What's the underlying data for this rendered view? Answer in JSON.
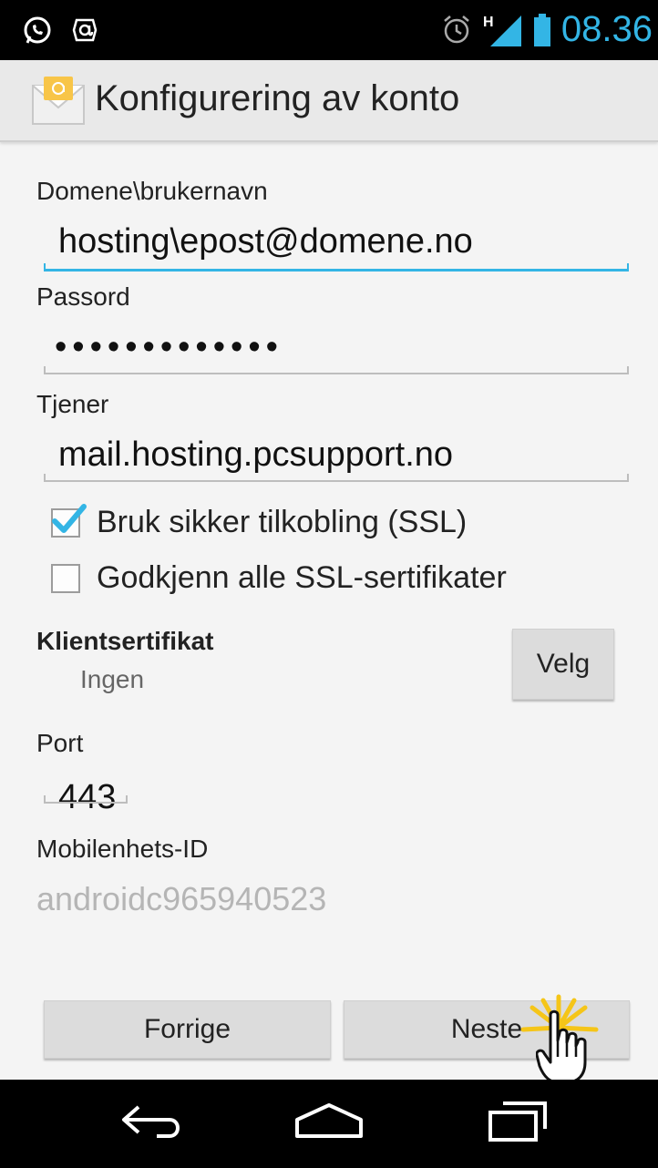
{
  "status_bar": {
    "time": "08.36",
    "network_type": "H",
    "icons": [
      "whatsapp-icon",
      "at-sign-icon",
      "alarm-icon",
      "signal-icon",
      "battery-icon"
    ]
  },
  "action_bar": {
    "title": "Konfigurering av konto",
    "app_icon": "email-envelope-icon"
  },
  "form": {
    "domain_user": {
      "label": "Domene\\brukernavn",
      "value": "hosting\\epost@domene.no"
    },
    "password": {
      "label": "Passord",
      "value": "•••••••••••••"
    },
    "server": {
      "label": "Tjener",
      "value": "mail.hosting.pcsupport.no"
    },
    "use_ssl": {
      "label": "Bruk sikker tilkobling (SSL)",
      "checked": true
    },
    "accept_all_certs": {
      "label": "Godkjenn alle SSL-sertifikater",
      "checked": false
    },
    "client_cert": {
      "label": "Klientsertifikat",
      "value": "Ingen",
      "button": "Velg"
    },
    "port": {
      "label": "Port",
      "value": "443"
    },
    "device_id": {
      "label": "Mobilenhets-ID",
      "value": "androidc965940523"
    }
  },
  "buttons": {
    "previous": "Forrige",
    "next": "Neste"
  },
  "nav_bar": {
    "icons": [
      "back-icon",
      "home-icon",
      "recent-apps-icon"
    ]
  },
  "colors": {
    "accent": "#33b5e5",
    "status_bar_bg": "#000000",
    "background": "#f4f4f4"
  }
}
